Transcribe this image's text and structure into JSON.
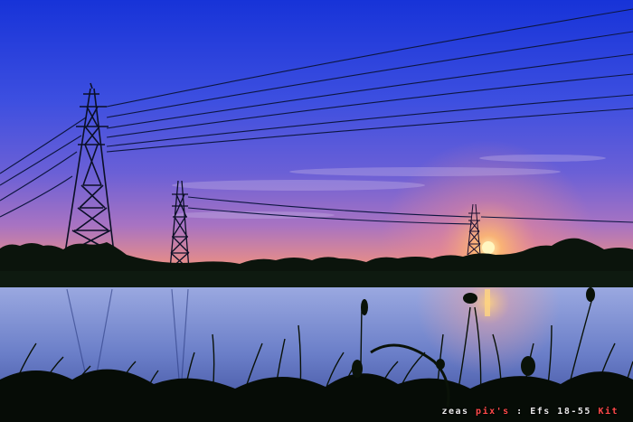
{
  "photo": {
    "description_free": true,
    "palette": {
      "sky_top": "#1c3fd6",
      "sky_mid": "#5a52d4",
      "horizon_pink": "#e0708a",
      "sun": "#ffd56a",
      "water": "#8aa0d8",
      "silhouette": "#0a1208"
    }
  },
  "watermark": {
    "prefix": "zeas ",
    "accent": "pix",
    "mark": "'s",
    "suffix": " : Efs 18-55 ",
    "end": "Kit"
  }
}
